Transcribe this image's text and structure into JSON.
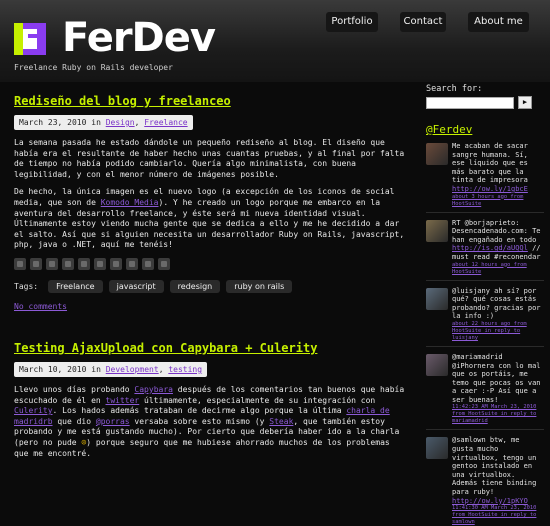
{
  "site": {
    "brand": "FerDev",
    "tagline": "Freelance Ruby on Rails developer"
  },
  "nav": {
    "items": [
      "Portfolio",
      "Contact",
      "About me"
    ]
  },
  "post1": {
    "title": "Rediseño del blog y freelanceo",
    "date_prefix": "March 23, 2010 in ",
    "category1": "Design",
    "comma": ", ",
    "category2": "Freelance",
    "p1": "La semana pasada he estado dándole un pequeño rediseño al blog. El diseño que había era el resultante de haber hecho unas cuantas pruebas, y al final por falta de tiempo no había podido cambiarlo. Quería algo minimalista, con buena legibilidad, y con el menor número de imágenes posible.",
    "p2_a": "De hecho, la única imagen es el nuevo logo (a excepción de los iconos de social media, que son de ",
    "p2_link": "Komodo Media",
    "p2_b": "). Y he creado un logo porque me embarco en la aventura del desarrollo freelance, y éste será mi nueva identidad visual. Últimamente estoy viendo mucha gente que se dedica a ello y me he decidido a dar el salto. Así que si alguien necesita un desarrollador Ruby on Rails, javascript, php, java o .NET, aquí me tenéis!",
    "tags_label": "Tags:",
    "tags": [
      "Freelance",
      "javascript",
      "redesign",
      "ruby on rails"
    ],
    "comments": "No comments"
  },
  "post2": {
    "title": "Testing AjaxUpload con Capybara + Culerity",
    "date_prefix": "March 10, 2010 in ",
    "category1": "Development",
    "comma": ", ",
    "category2": "testing",
    "t1": "Llevo unos días probando ",
    "l1": "Capybara",
    "t2": " después de los comentarios tan buenos que había escuchado de él en ",
    "l2": "twitter",
    "t3": " últimamente, especialmente de su integración con ",
    "l3": "Culerity",
    "t4": ". Los hados además trataban de decirme algo porque la última ",
    "l4": "charla de madridrb",
    "t5": " que dio ",
    "l5": "@porras",
    "t6": " versaba sobre esto mismo (y ",
    "l6": "Steak",
    "t7": ", que también estoy probando y me está gustando mucho). Por cierto que debería haber ido a la charla (pero no pude ",
    "smiley": "☹",
    "t8": ") porque seguro que me hubiese ahorrado muchos de los problemas que me encontré."
  },
  "sidebar": {
    "search_label": "Search for:",
    "search_button": "▶",
    "twitter_handle": "@Ferdev",
    "tweets": [
      {
        "text": "Me acaban de sacar sangre humana. Sí, ese líquido que es más barato que la tinta de impresora ",
        "link": "http://ow.ly/1gbcE",
        "meta": "about 3 hours ago from HootSuite"
      },
      {
        "text": "RT @borjaprieto: Desencadenado.com: Te han engañado en todo ",
        "link": "http://is.gd/aUQQl",
        "text2": " // must read #reconendar",
        "meta": "about 12 hours ago from HootSuite"
      },
      {
        "text": "@luisjany ah sí? por qué? qué cosas estás probando? gracias por la info :)",
        "link": "",
        "meta": "about 22 hours ago from HootSuite in reply to luisjany"
      },
      {
        "text": "@mariamadrid @iPhornera con lo mal que os portáis, me temo que pocas os van a caer :-P Así que a ser buenas!",
        "link": "",
        "meta": "11:42:23 AM March 23, 2010 from HootSuite in reply to mariamadrid"
      },
      {
        "text": "@samlown btw, me gusta mucho virtualbox, tengo un gentoo instalado en una virtualbox. Además tiene binding para ruby! ",
        "link": "http://ow.ly/1pKYO",
        "meta": "11:41:30 AM March 23, 2010 from HootSuite in reply to samlown"
      }
    ]
  },
  "colors": {
    "accent": "#c6f000",
    "link": "#8c5ad6",
    "background": "#0b0b0b",
    "logo_yellow": "#c6f000",
    "logo_purple": "#8a3cf0",
    "logo_white": "#ffffff"
  },
  "icons": {
    "logo": "ferdev-logo-icon",
    "share": [
      "rss-icon",
      "delicious-icon",
      "digg-icon",
      "email-icon",
      "facebook-icon",
      "twitter-icon",
      "stumbleupon-icon",
      "reddit-icon",
      "technorati-icon",
      "linkedin-icon"
    ]
  }
}
